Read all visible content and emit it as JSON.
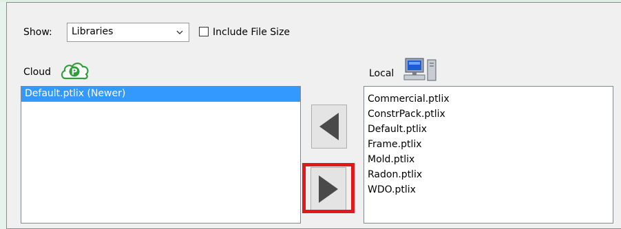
{
  "window": {
    "show_label": "Show:",
    "show_select_value": "Libraries",
    "include_file_size_label": "Include File Size",
    "include_file_size_checked": false
  },
  "cloud": {
    "label": "Cloud",
    "icon": "cloud-p-icon",
    "items": [
      "Default.ptlix (Newer)"
    ],
    "selected_index": 0
  },
  "local": {
    "label": "Local",
    "icon": "computer-icon",
    "items": [
      "Commercial.ptlix",
      "ConstrPack.ptlix",
      "Default.ptlix",
      "Frame.ptlix",
      "Mold.ptlix",
      "Radon.ptlix",
      "WDO.ptlix"
    ]
  },
  "buttons": {
    "download_icon": "arrow-left-icon",
    "upload_icon": "arrow-right-icon"
  },
  "colors": {
    "selection": "#3399ff",
    "highlight": "#e0191a",
    "arrow": "#4a4a4a"
  }
}
